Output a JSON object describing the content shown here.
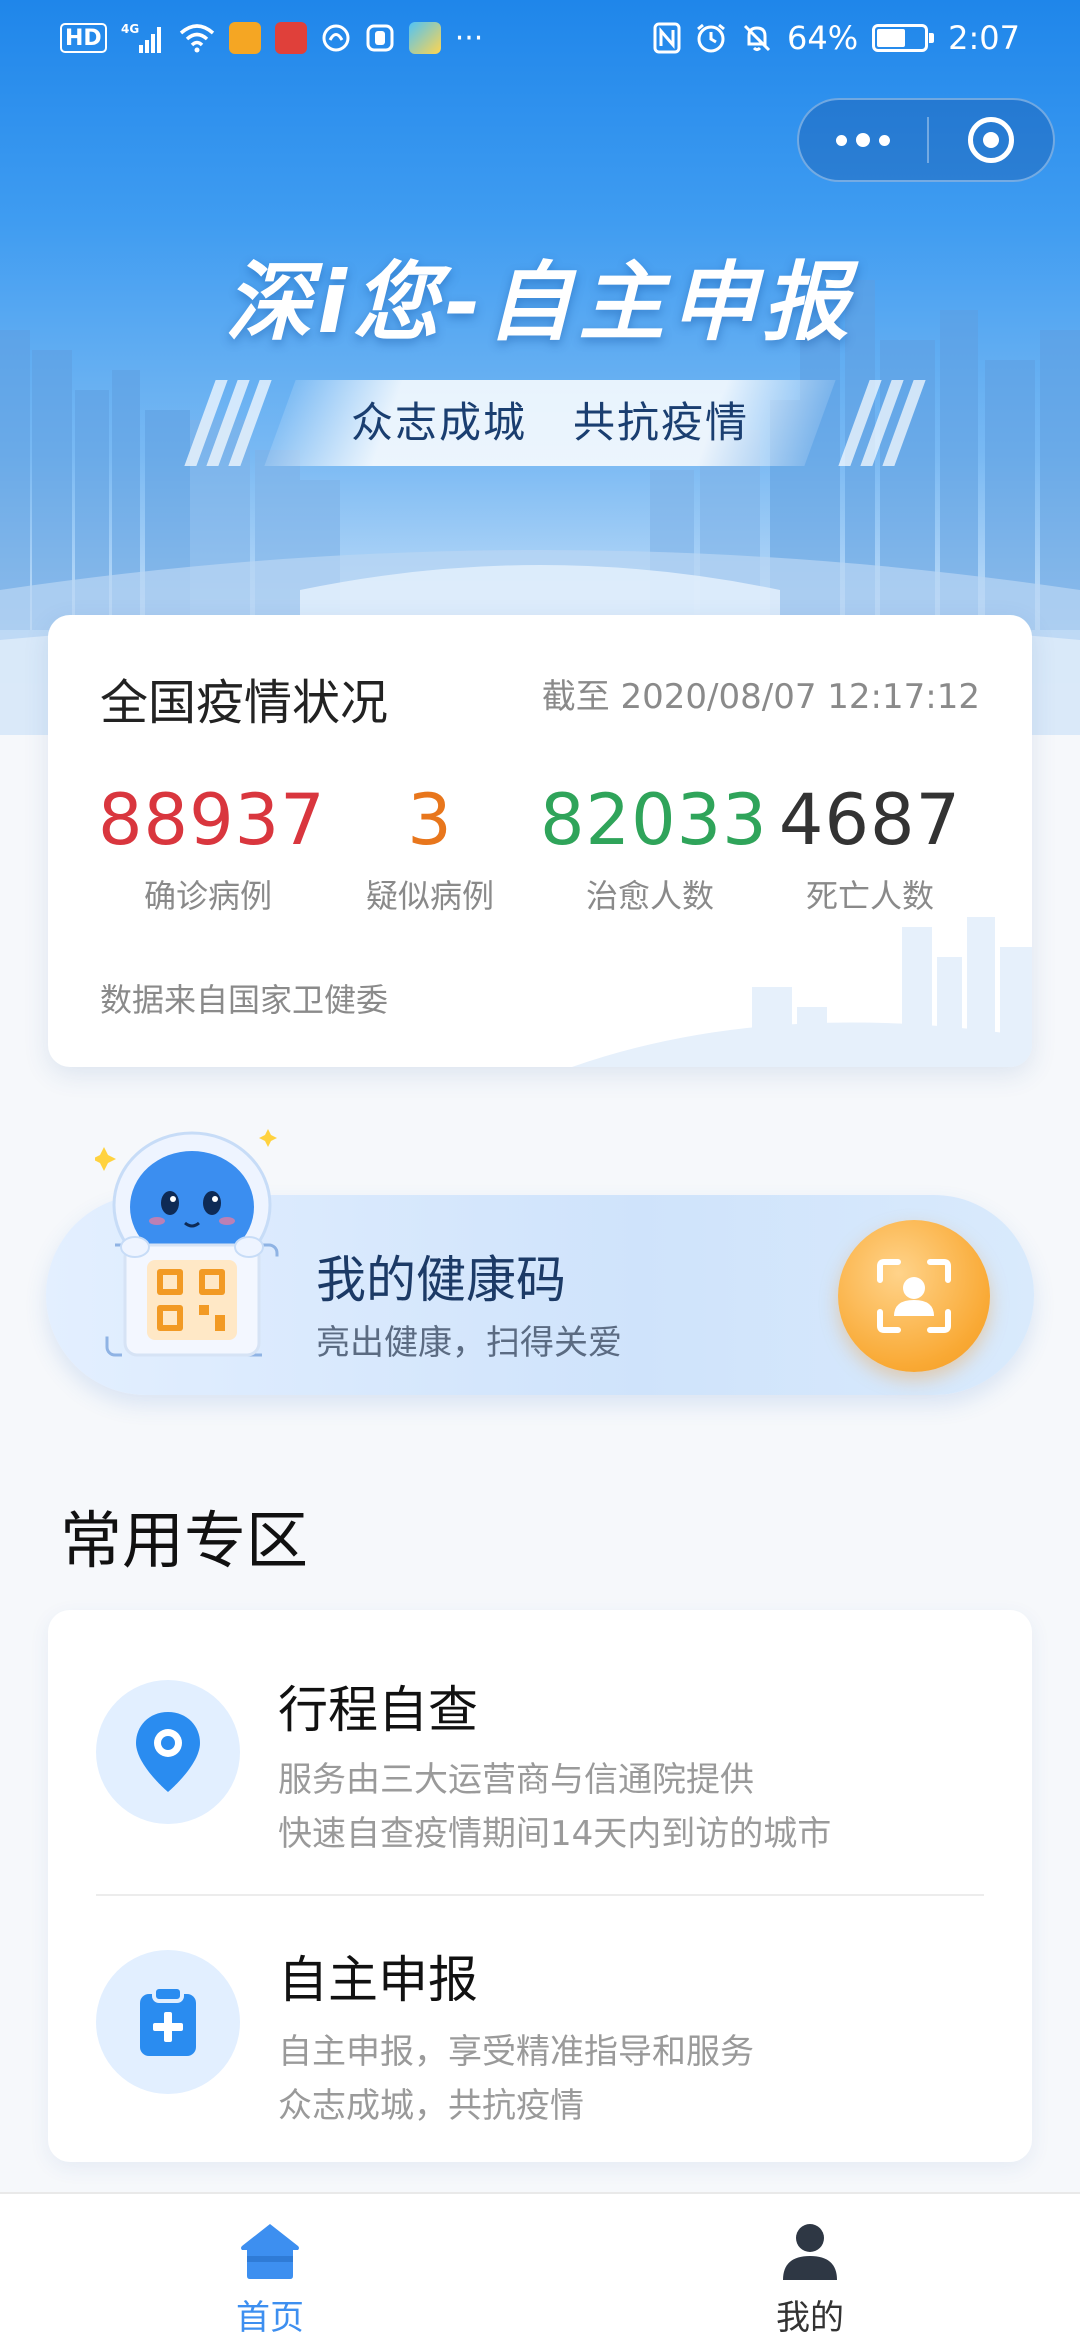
{
  "status_bar": {
    "network": "HD",
    "signal_tag": "4G",
    "more_icons": "···",
    "battery_percent": "64%",
    "battery_level": 0.64,
    "time": "2:07"
  },
  "header": {
    "title": "深i您-自主申报",
    "slogan": "众志成城   共抗疫情"
  },
  "stats": {
    "title": "全国疫情状况",
    "updated": "截至 2020/08/07 12:17:12",
    "items": [
      {
        "value": "88937",
        "label": "确诊病例",
        "color": "#d9363e"
      },
      {
        "value": "3",
        "label": "疑似病例",
        "color": "#e8761c"
      },
      {
        "value": "82033",
        "label": "治愈人数",
        "color": "#2fa45a"
      },
      {
        "value": "4687",
        "label": "死亡人数",
        "color": "#333333"
      }
    ],
    "source": "数据来自国家卫健委"
  },
  "health_code": {
    "title": "我的健康码",
    "subtitle": "亮出健康，扫得关爱"
  },
  "common_zone": {
    "title": "常用专区",
    "services": [
      {
        "title": "行程自查",
        "line1": "服务由三大运营商与信通院提供",
        "line2": "快速自查疫情期间14天内到访的城市",
        "icon": "location-pin-icon"
      },
      {
        "title": "自主申报",
        "line1": "自主申报，享受精准指导和服务",
        "line2": "众志成城，共抗疫情",
        "icon": "clipboard-plus-icon"
      }
    ]
  },
  "tabbar": {
    "items": [
      {
        "label": "首页",
        "icon": "home-icon",
        "active": true
      },
      {
        "label": "我的",
        "icon": "user-icon",
        "active": false
      }
    ]
  },
  "colors": {
    "primary": "#2a8cf0",
    "tab_active": "#3d8ff0",
    "tab_inactive": "#333333",
    "scan_button": "#f9a934"
  }
}
